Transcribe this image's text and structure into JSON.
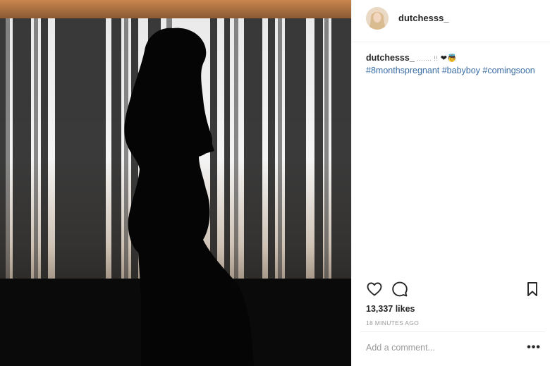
{
  "post": {
    "author": "dutchesss_",
    "caption": {
      "username": "dutchesss_",
      "text": "....... !!",
      "emoji": "❤👼",
      "hashtags": "#8monthspregnant #babyboy #comingsoon"
    },
    "likes": "13,337 likes",
    "timestamp": "18 MINUTES AGO",
    "comment_placeholder": "Add a comment...",
    "more_options": "•••"
  },
  "icons": {
    "like": "heart-icon",
    "comment": "speech-bubble-icon",
    "save": "bookmark-icon",
    "more": "more-options-icon"
  },
  "colors": {
    "hashtag": "#3b6fa6",
    "muted": "#999999",
    "text": "#262626",
    "divider": "#efefef"
  }
}
